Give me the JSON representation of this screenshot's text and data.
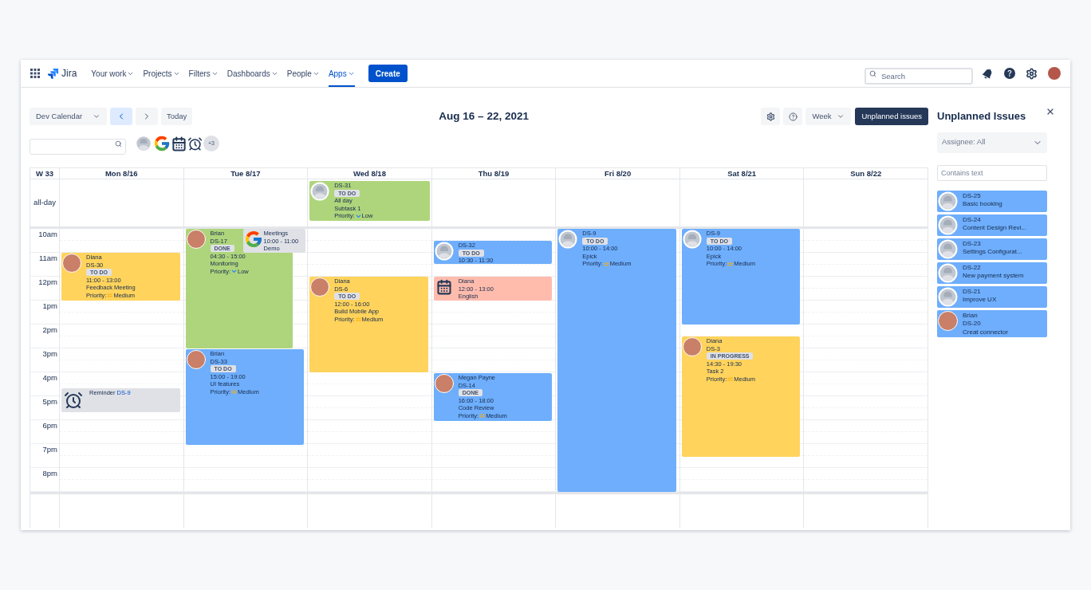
{
  "nav": {
    "logo": "Jira",
    "items": [
      {
        "label": "Your work",
        "selected": false
      },
      {
        "label": "Projects",
        "selected": false
      },
      {
        "label": "Filters",
        "selected": false
      },
      {
        "label": "Dashboards",
        "selected": false
      },
      {
        "label": "People",
        "selected": false
      },
      {
        "label": "Apps",
        "selected": true
      }
    ],
    "create": "Create",
    "search": {
      "placeholder": "Search"
    }
  },
  "toolbar": {
    "calendar": "Dev Calendar",
    "nav_buttons": [
      {
        "kind": "prev",
        "selected": true
      },
      {
        "kind": "next",
        "selected": false
      }
    ],
    "today": "Today",
    "range": "Aug 16 – 22, 2021",
    "view": "Week",
    "unplanned": "Unplanned issues",
    "sources": [
      {
        "kind": "person"
      },
      {
        "kind": "google"
      },
      {
        "kind": "calendar"
      },
      {
        "kind": "reminder"
      }
    ],
    "more_count": "+3"
  },
  "calendar": {
    "week": "W 33",
    "allday_label": "all-day",
    "hours": [
      "10am",
      "11am",
      "12pm",
      "1pm",
      "2pm",
      "3pm",
      "4pm",
      "5pm",
      "6pm",
      "7pm",
      "8pm"
    ],
    "days": [
      {
        "label": "Mon 8/16",
        "events": [
          {
            "kind": "issue",
            "color": "#ffd35c",
            "has_photo": true,
            "name": "Diana",
            "key": "DS-30",
            "status": "TO DO",
            "time": "11:00 - 13:00",
            "title": "Feedback Meeting",
            "priority": {
              "label": "Priority:",
              "value": "Medium",
              "kind": "medium"
            }
          },
          {
            "kind": "reminder",
            "color": "#dfe1e6",
            "text": "Reminder",
            "link": "DS-9"
          }
        ]
      },
      {
        "label": "Tue 8/17",
        "events": [
          {
            "kind": "issue",
            "color": "#aed57b",
            "has_photo": true,
            "name": "Brian",
            "key": "DS-17",
            "status": "DONE",
            "time": "04:30 - 15:00",
            "title": "Monitoring",
            "priority": {
              "label": "Priority:",
              "value": "Low",
              "kind": "low"
            }
          },
          {
            "kind": "google",
            "color": "#dfe1e6",
            "name": "Meetings",
            "time": "10:00 - 11:00",
            "title": "Demo"
          },
          {
            "kind": "issue",
            "color": "#6eaefc",
            "has_photo": true,
            "name": "Brian",
            "key": "DS-33",
            "status": "TO DO",
            "time": "15:00 - 19:00",
            "title": "UI features",
            "priority": {
              "label": "Priority:",
              "value": "Medium",
              "kind": "medium"
            }
          }
        ]
      },
      {
        "label": "Wed 8/18",
        "allday": [
          {
            "kind": "issue",
            "color": "#aed57b",
            "has_photo": false,
            "key": "DS-31",
            "status": "TO DO",
            "time": "All day",
            "title": "Subtask 1",
            "priority": {
              "label": "Priority:",
              "value": "Low",
              "kind": "low"
            }
          }
        ],
        "events": [
          {
            "kind": "issue",
            "color": "#ffd35c",
            "has_photo": true,
            "name": "Diana",
            "key": "DS-6",
            "status": "TO DO",
            "time": "12:00 - 16:00",
            "title": "Build Mobile App",
            "priority": {
              "label": "Priority:",
              "value": "Medium",
              "kind": "medium"
            }
          }
        ]
      },
      {
        "label": "Thu 8/19",
        "events": [
          {
            "kind": "issue",
            "color": "#6eaefc",
            "has_photo": false,
            "key": "DS-32",
            "status": "TO DO",
            "time": "10:30 - 11:30"
          },
          {
            "kind": "calendar",
            "color": "#ffbcad",
            "name": "Diana",
            "time": "12:00 - 13:00",
            "title": "English"
          },
          {
            "kind": "issue",
            "color": "#6eaefc",
            "has_photo": true,
            "name": "Megan Payne",
            "key": "DS-14",
            "status": "DONE",
            "time": "16:00 - 18:00",
            "title": "Code Review",
            "priority": {
              "label": "Priority:",
              "value": "Medium",
              "kind": "medium"
            }
          }
        ]
      },
      {
        "label": "Fri 8/20",
        "events": [
          {
            "kind": "issue",
            "color": "#6eaefc",
            "has_photo": false,
            "key": "DS-9",
            "status": "TO DO",
            "time": "10:00 - 14:00",
            "title": "Epick",
            "priority": {
              "label": "Priority:",
              "value": "Medium",
              "kind": "medium"
            }
          }
        ]
      },
      {
        "label": "Sat 8/21",
        "events": [
          {
            "kind": "issue",
            "color": "#6eaefc",
            "has_photo": false,
            "key": "DS-9",
            "status": "TO DO",
            "time": "10:00 - 14:00",
            "title": "Epick",
            "priority": {
              "label": "Priority:",
              "value": "Medium",
              "kind": "medium"
            }
          },
          {
            "kind": "issue",
            "color": "#ffd35c",
            "has_photo": true,
            "name": "Diana",
            "key": "DS-3",
            "status": "IN PROGRESS",
            "time": "14:30 - 19:30",
            "title": "Task 2",
            "priority": {
              "label": "Priority:",
              "value": "Medium",
              "kind": "medium"
            }
          }
        ]
      },
      {
        "label": "Sun 8/22"
      }
    ]
  },
  "unplanned": {
    "title": "Unplanned Issues",
    "assignee": "Assignee: All",
    "filter_placeholder": "Contains text",
    "issues": [
      {
        "has_photo": false,
        "key": "DS-25",
        "title": "Basic booking"
      },
      {
        "has_photo": false,
        "key": "DS-24",
        "title": "Content Design Revi..."
      },
      {
        "has_photo": false,
        "key": "DS-23",
        "title": "Settings Configurat..."
      },
      {
        "has_photo": false,
        "key": "DS-22",
        "title": "New payment system"
      },
      {
        "has_photo": false,
        "key": "DS-21",
        "title": "Improve UX"
      },
      {
        "has_photo": true,
        "name": "Brian",
        "key": "DS-20",
        "title": "Creat connector"
      }
    ]
  }
}
